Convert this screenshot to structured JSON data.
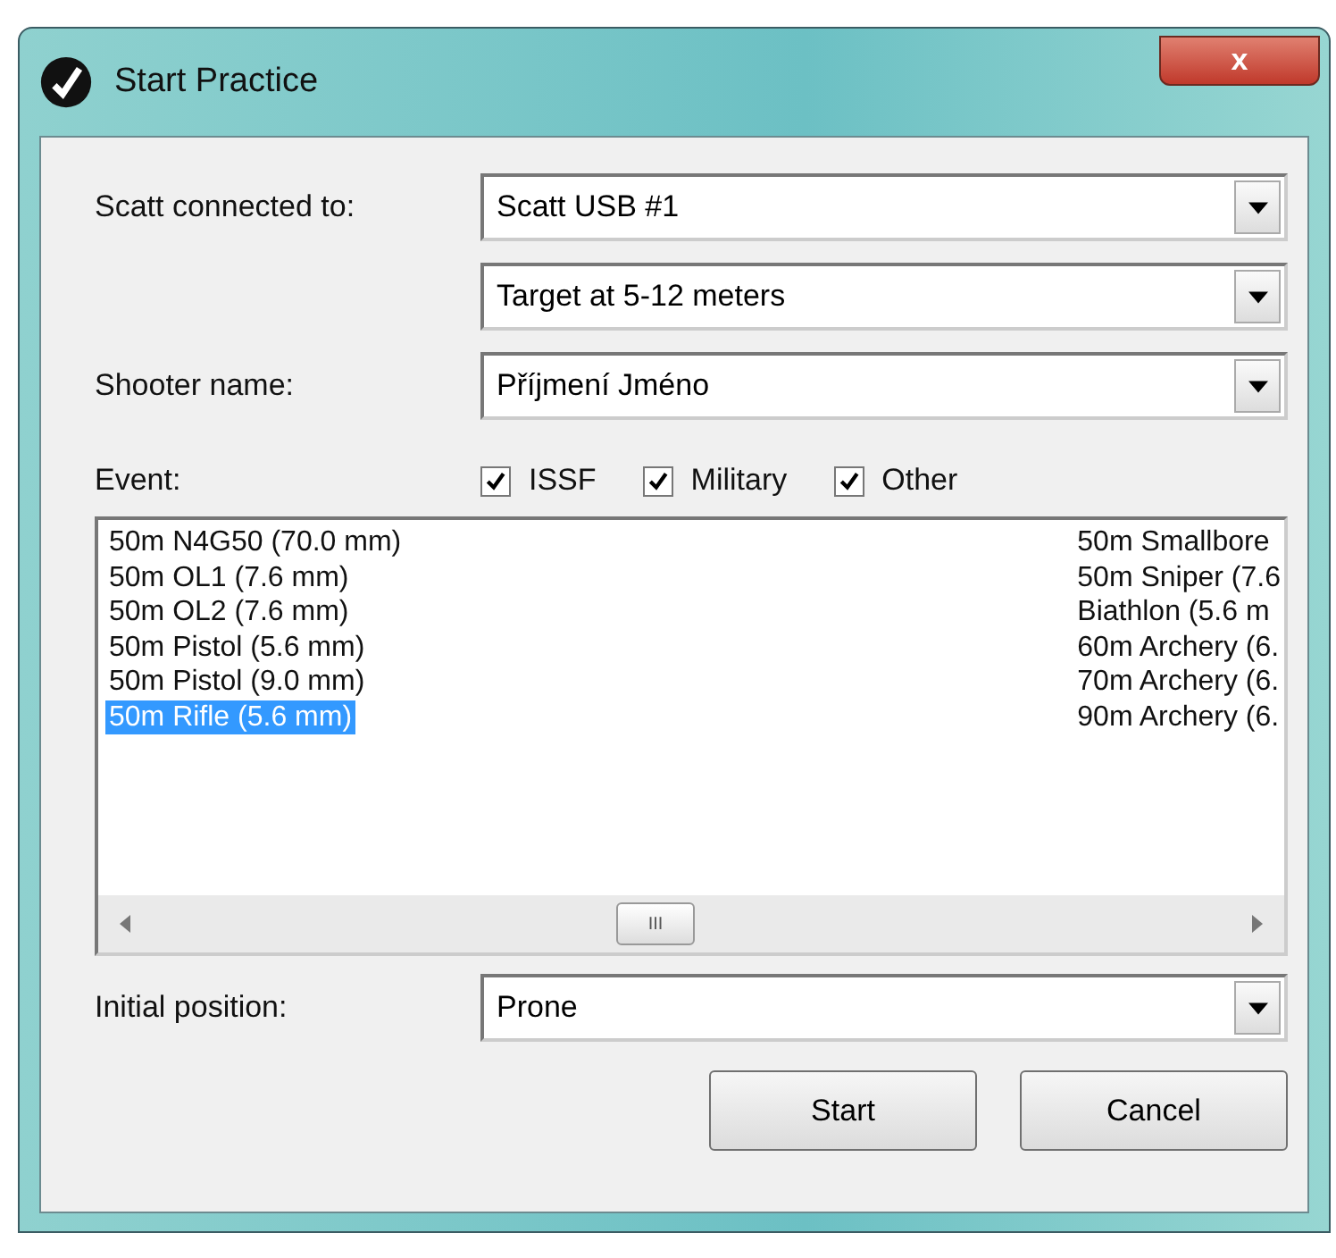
{
  "window": {
    "title": "Start Practice",
    "close": "x"
  },
  "fields": [
    {
      "label": "Scatt connected to:",
      "value": "Scatt USB #1"
    },
    {
      "value": "Target at 5-12 meters"
    },
    {
      "label": "Shooter name:",
      "value": "Příjmení Jméno"
    }
  ],
  "event": {
    "label": "Event:",
    "filters": [
      {
        "label": "ISSF",
        "checked": true
      },
      {
        "label": "Military",
        "checked": true
      },
      {
        "label": "Other",
        "checked": true
      }
    ]
  },
  "event_list": {
    "columns": [
      [
        {
          "label": "50m N4G50 (70.0 mm)",
          "selected": false
        },
        {
          "label": "50m OL1 (7.6 mm)",
          "selected": false
        },
        {
          "label": "50m OL2 (7.6 mm)",
          "selected": false
        },
        {
          "label": "50m Pistol (5.6 mm)",
          "selected": false
        },
        {
          "label": "50m Pistol (9.0 mm)",
          "selected": false
        },
        {
          "label": "50m Rifle (5.6 mm)",
          "selected": true
        }
      ],
      [
        {
          "label": "50m Smallbore",
          "selected": false
        },
        {
          "label": "50m Sniper (7.6",
          "selected": false
        },
        {
          "label": "Biathlon (5.6 m",
          "selected": false
        },
        {
          "label": "60m Archery (6.",
          "selected": false
        },
        {
          "label": "70m Archery (6.",
          "selected": false
        },
        {
          "label": "90m Archery (6.",
          "selected": false
        }
      ]
    ],
    "scrollbar_grip": "III"
  },
  "initial_position": {
    "label": "Initial position:",
    "value": "Prone"
  },
  "buttons": [
    "Start",
    "Cancel"
  ]
}
